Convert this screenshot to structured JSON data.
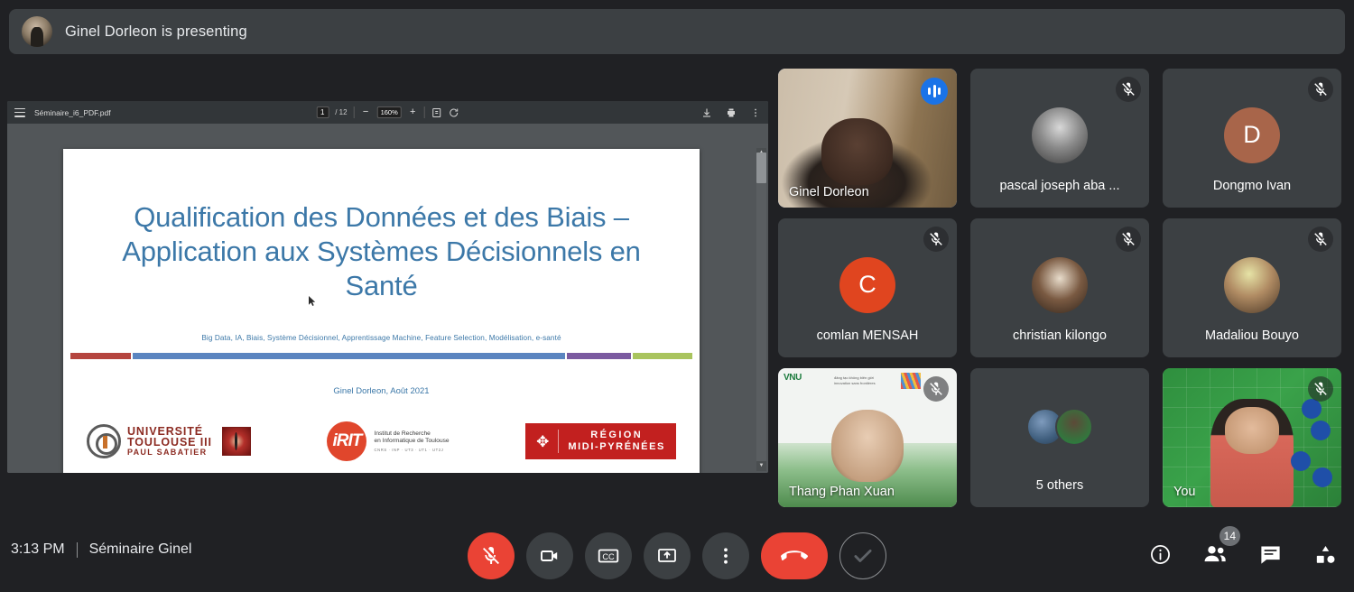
{
  "banner": {
    "text": "Ginel Dorleon is presenting",
    "avatar_name": "presenter-avatar"
  },
  "pdf_viewer": {
    "filename": "Séminaire_i6_PDF.pdf",
    "page_current": "1",
    "page_separator": "/ 12",
    "page_total": "12",
    "zoom_level": "160%",
    "zoom_out_label": "−",
    "zoom_in_label": "+",
    "icons": {
      "menu": "hamburger-icon",
      "fit": "fit-page-icon",
      "rotate": "rotate-icon",
      "download": "download-icon",
      "print": "print-icon",
      "more": "more-options-icon"
    }
  },
  "slide": {
    "title": "Qualification des Données et des Biais – Application aux Systèmes Décisionnels en Santé",
    "keywords": "Big Data, IA, Biais, Système Décisionnel, Apprentissage Machine, Feature Selection, Modélisation, e-santé",
    "author": "Ginel Dorleon, Août 2021",
    "color_bars": [
      {
        "color": "#b5453f",
        "flex": 55
      },
      {
        "color": "#5b85c0",
        "flex": 392
      },
      {
        "color": "#7b5aa0",
        "flex": 58
      },
      {
        "color": "#a9c45e",
        "flex": 54
      }
    ],
    "logos": {
      "university": {
        "line1": "UNIVERSITÉ",
        "line2": "TOULOUSE III",
        "line3": "PAUL SABATIER"
      },
      "irit": {
        "mark": "iRIT",
        "line1": "Institut de Recherche",
        "line2": "en Informatique de Toulouse",
        "line3": "CNRS · INP · UT3 · UT1 · UT2J"
      },
      "region": {
        "symbol": "✥",
        "line1": "RÉGION",
        "line2": "MIDI-PYRÉNÉES"
      }
    }
  },
  "participants": [
    [
      {
        "name": "Ginel Dorleon",
        "kind": "video",
        "video": "ginel",
        "speaking": true,
        "muted": false,
        "name_position": "bottom-left"
      },
      {
        "name": "pascal joseph aba ...",
        "kind": "photo",
        "avatar_color": "#5f6368",
        "initial": "",
        "speaking": false,
        "muted": true,
        "name_position": "center"
      },
      {
        "name": "Dongmo Ivan",
        "kind": "initial",
        "avatar_color": "#a8654a",
        "initial": "D",
        "speaking": false,
        "muted": true,
        "name_position": "center"
      }
    ],
    [
      {
        "name": "comlan MENSAH",
        "kind": "initial",
        "avatar_color": "#e0451f",
        "initial": "C",
        "speaking": false,
        "muted": true,
        "name_position": "center"
      },
      {
        "name": "christian kilongo",
        "kind": "photo",
        "avatar_color": "#6b5a4a",
        "initial": "",
        "speaking": false,
        "muted": true,
        "name_position": "center"
      },
      {
        "name": "Madaliou Bouyo",
        "kind": "photo",
        "avatar_color": "#7d6b4f",
        "initial": "",
        "speaking": false,
        "muted": true,
        "name_position": "center"
      }
    ],
    [
      {
        "name": "Thang Phan Xuan",
        "kind": "video",
        "video": "thang",
        "speaking": false,
        "muted": true,
        "name_position": "bottom-left"
      },
      {
        "name": "5 others",
        "kind": "others",
        "speaking": false,
        "muted": false,
        "name_position": "center"
      },
      {
        "name": "You",
        "kind": "video",
        "video": "you",
        "speaking": false,
        "muted": true,
        "name_position": "bottom-left"
      }
    ]
  ],
  "bottom_bar": {
    "time": "3:13 PM",
    "meeting_name": "Séminaire Ginel",
    "controls": [
      {
        "name": "microphone-off-button",
        "icon": "mic-off-icon",
        "style": "danger"
      },
      {
        "name": "camera-button",
        "icon": "camera-icon",
        "style": "normal"
      },
      {
        "name": "captions-button",
        "icon": "cc-icon",
        "style": "normal"
      },
      {
        "name": "present-button",
        "icon": "present-icon",
        "style": "normal"
      },
      {
        "name": "more-options-button",
        "icon": "more-vert-icon",
        "style": "normal"
      },
      {
        "name": "leave-call-button",
        "icon": "hangup-icon",
        "style": "hangup"
      },
      {
        "name": "raise-hand-button",
        "icon": "check-icon",
        "style": "check"
      }
    ],
    "right_items": [
      {
        "name": "meeting-details-button",
        "icon": "info-icon",
        "badge": ""
      },
      {
        "name": "participants-button",
        "icon": "people-icon",
        "badge": "14"
      },
      {
        "name": "chat-button",
        "icon": "chat-icon",
        "badge": ""
      },
      {
        "name": "activities-button",
        "icon": "activities-icon",
        "badge": ""
      }
    ]
  },
  "colors": {
    "background": "#202124",
    "tile": "#3c4043",
    "accent_blue": "#8ab4f8",
    "danger_red": "#ea4335",
    "slide_blue": "#3c78a8"
  }
}
